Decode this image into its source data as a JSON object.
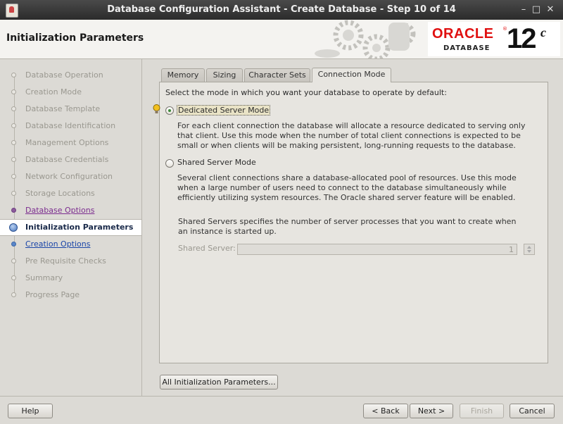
{
  "window": {
    "title": "Database Configuration Assistant - Create Database - Step 10 of 14"
  },
  "header": {
    "page_title": "Initialization Parameters",
    "logo": {
      "oracle": "ORACLE",
      "registered": "®",
      "database": "DATABASE",
      "version": "12",
      "version_suffix": "c",
      "color": "#e01010"
    }
  },
  "steps": [
    {
      "label": "Database Operation",
      "state": "done"
    },
    {
      "label": "Creation Mode",
      "state": "done"
    },
    {
      "label": "Database Template",
      "state": "done"
    },
    {
      "label": "Database Identification",
      "state": "done"
    },
    {
      "label": "Management Options",
      "state": "done"
    },
    {
      "label": "Database Credentials",
      "state": "done"
    },
    {
      "label": "Network Configuration",
      "state": "done"
    },
    {
      "label": "Storage Locations",
      "state": "done"
    },
    {
      "label": "Database Options",
      "state": "visited"
    },
    {
      "label": "Initialization Parameters",
      "state": "current"
    },
    {
      "label": "Creation Options",
      "state": "next"
    },
    {
      "label": "Pre Requisite Checks",
      "state": "pending"
    },
    {
      "label": "Summary",
      "state": "pending"
    },
    {
      "label": "Progress Page",
      "state": "pending"
    }
  ],
  "tabs": [
    {
      "label": "Memory",
      "active": false
    },
    {
      "label": "Sizing",
      "active": false
    },
    {
      "label": "Character Sets",
      "active": false
    },
    {
      "label": "Connection Mode",
      "active": true
    }
  ],
  "connection_mode": {
    "prompt": "Select the mode in which you want your database to operate by default:",
    "dedicated": {
      "label": "Dedicated Server Mode",
      "selected": true,
      "desc": "For each client connection the database will allocate a resource dedicated to serving only that client.  Use this mode when the number of total client connections is expected to be small or when clients will be making persistent, long-running requests to the database."
    },
    "shared": {
      "label": "Shared Server Mode",
      "selected": false,
      "desc": "Several client connections share a database-allocated pool of resources.  Use this mode when a large number of users need to connect to the database simultaneously while efficiently utilizing system resources.  The Oracle shared server feature will be enabled.",
      "servers_desc": "Shared Servers specifies the number of server processes that you want to create when an instance is started up.",
      "field_label": "Shared Server:",
      "field_value": "1"
    }
  },
  "buttons": {
    "all_params": "All Initialization Parameters...",
    "help": "Help",
    "back": "< Back",
    "next": "Next >",
    "finish": "Finish",
    "cancel": "Cancel"
  }
}
